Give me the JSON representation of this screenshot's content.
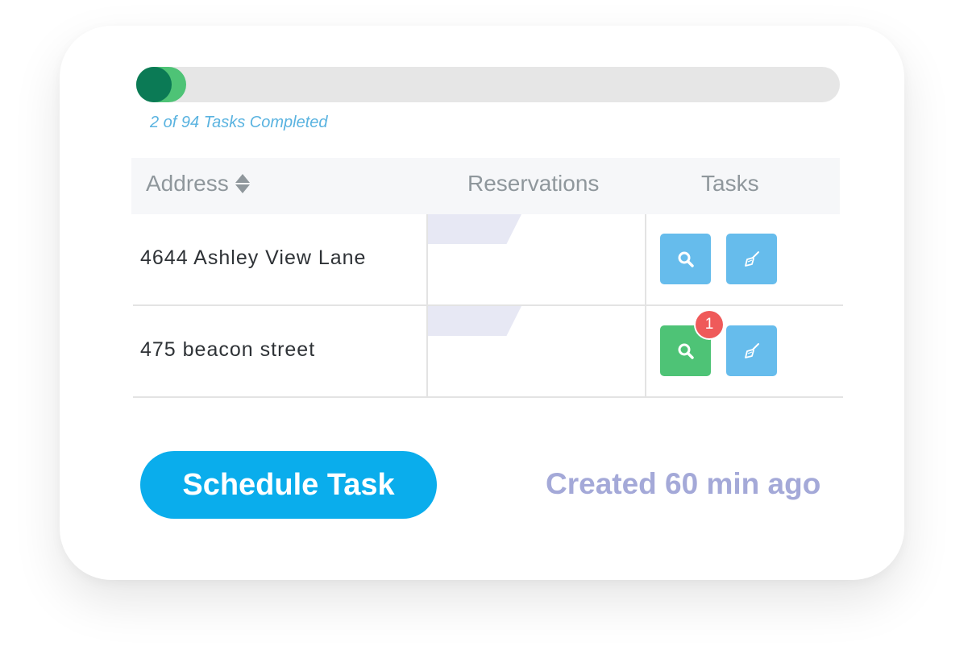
{
  "progress": {
    "completed": 2,
    "total": 94,
    "fraction": 0.0213,
    "label": "2 of 94 Tasks Completed",
    "colors": {
      "fill": "#4ec376",
      "knob": "#0b7a55",
      "track": "#e6e6e6"
    }
  },
  "table": {
    "headers": {
      "address": "Address",
      "reservations": "Reservations",
      "tasks": "Tasks"
    },
    "rows": [
      {
        "address": "4644 Ashley View Lane",
        "search_status": "default",
        "badge": ""
      },
      {
        "address": "475 beacon street",
        "search_status": "active",
        "badge": "1"
      }
    ],
    "icons": {
      "sort": "sort-icon",
      "search": "search-icon",
      "clean": "broom-icon"
    }
  },
  "footer": {
    "schedule_label": "Schedule Task",
    "created_text": "Created 60 min ago"
  },
  "colors": {
    "primary": "#0aadec",
    "task_blue": "#66bcec",
    "task_green": "#4ec376",
    "badge_red": "#ef5a5a",
    "muted_purple": "#a4a9d8"
  }
}
